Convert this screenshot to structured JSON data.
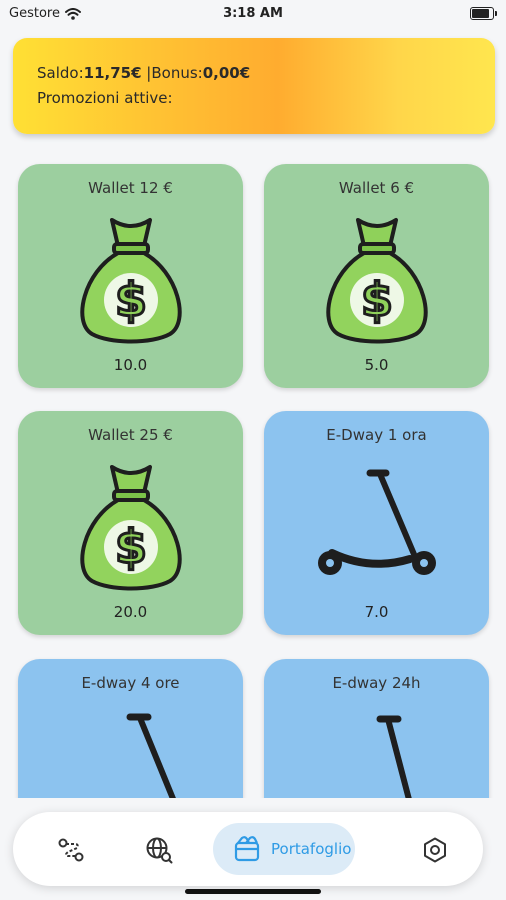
{
  "status_bar": {
    "carrier": "Gestore",
    "time": "3:18 AM"
  },
  "balance": {
    "saldo_label": "Saldo:",
    "saldo_value": "11,75€",
    "separator": " |",
    "bonus_label": "Bonus:",
    "bonus_value": "0,00€",
    "promotions_label": "Promozioni attive:"
  },
  "products": [
    {
      "title": "Wallet 12 €",
      "value": "10.0",
      "type": "wallet",
      "color": "#9ccf9f"
    },
    {
      "title": "Wallet 6 €",
      "value": "5.0",
      "type": "wallet",
      "color": "#9ccf9f"
    },
    {
      "title": "Wallet 25 €",
      "value": "20.0",
      "type": "wallet",
      "color": "#9ccf9f"
    },
    {
      "title": "E-Dway 1 ora",
      "value": "7.0",
      "type": "scooter",
      "color": "#8cc3ef"
    },
    {
      "title": "E-dway 4 ore",
      "value": "",
      "type": "scooter",
      "color": "#8cc3ef"
    },
    {
      "title": "E-dway 24h",
      "value": "",
      "type": "scooter",
      "color": "#8cc3ef"
    }
  ],
  "nav": {
    "items": [
      {
        "icon": "route-icon"
      },
      {
        "icon": "globe-search-icon"
      },
      {
        "icon": "wallet-icon",
        "label": "Portafoglio",
        "active": true
      },
      {
        "icon": "settings-icon"
      }
    ],
    "active_color": "#2f9be5"
  }
}
